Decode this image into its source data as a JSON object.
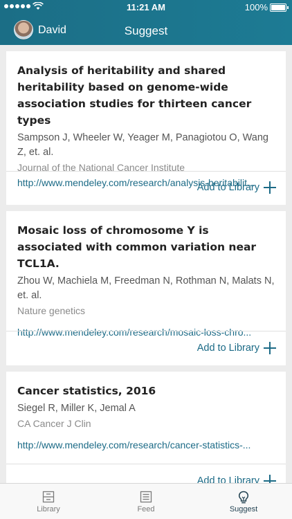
{
  "status": {
    "time": "11:21 AM",
    "battery": "100%"
  },
  "header": {
    "user_name": "David",
    "title": "Suggest"
  },
  "cards": [
    {
      "title": "Analysis of heritability and shared heritability based on genome-wide association studies for thirteen cancer types",
      "authors": "Sampson J, Wheeler W, Yeager M, Panagiotou O, Wang Z, et. al.",
      "journal": "Journal of the National Cancer Institute",
      "link": "http://www.mendeley.com/research/analysis-heritabilit...",
      "action": "Add to Library"
    },
    {
      "title": "Mosaic loss of chromosome Y is associated with common variation near TCL1A.",
      "authors": "Zhou W, Machiela M, Freedman N, Rothman N, Malats N, et. al.",
      "journal": "Nature genetics",
      "link": "http://www.mendeley.com/research/mosaic-loss-chro...",
      "action": "Add to Library"
    },
    {
      "title": "Cancer statistics, 2016",
      "authors": "Siegel R, Miller K, Jemal A",
      "journal": "CA Cancer J Clin",
      "link": "http://www.mendeley.com/research/cancer-statistics-...",
      "action": "Add to Library"
    }
  ],
  "tabs": [
    {
      "label": "Library",
      "icon": "library-icon"
    },
    {
      "label": "Feed",
      "icon": "feed-icon"
    },
    {
      "label": "Suggest",
      "icon": "lightbulb-icon",
      "active": true
    }
  ],
  "colors": {
    "header": "#1b6e86",
    "accent": "#1b6a86",
    "active_tab": "#1f3f4f"
  }
}
